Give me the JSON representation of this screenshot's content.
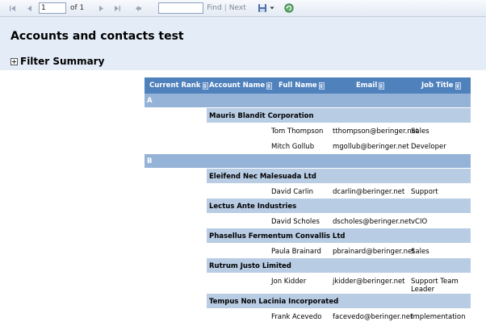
{
  "toolbar": {
    "page_value": "1",
    "of_label": "of 1",
    "find_label": "Find",
    "find_sep": "|",
    "next_label": "Next"
  },
  "report": {
    "title": "Accounts and contacts test",
    "filter_summary": "Filter Summary"
  },
  "table": {
    "columns": [
      "Current Rank",
      "Account Name",
      "Full Name",
      "Email",
      "Job Title"
    ],
    "groups": [
      {
        "label": "A",
        "accounts": [
          {
            "name": "Mauris Blandit Corporation",
            "contacts": [
              {
                "full_name": "Tom Thompson",
                "email": "tthompson@beringer.net",
                "job_title": "Sales"
              },
              {
                "full_name": "Mitch Gollub",
                "email": "mgollub@beringer.net",
                "job_title": "Developer"
              }
            ]
          }
        ]
      },
      {
        "label": "B",
        "accounts": [
          {
            "name": "Eleifend Nec Malesuada Ltd",
            "contacts": [
              {
                "full_name": "David Carlin",
                "email": "dcarlin@beringer.net",
                "job_title": "Support"
              }
            ]
          },
          {
            "name": "Lectus Ante Industries",
            "contacts": [
              {
                "full_name": "David Scholes",
                "email": "dscholes@beringer.net",
                "job_title": "vCIO"
              }
            ]
          },
          {
            "name": "Phasellus Fermentum Convallis Ltd",
            "contacts": [
              {
                "full_name": "Paula Brainard",
                "email": "pbrainard@beringer.net",
                "job_title": "Sales"
              }
            ]
          },
          {
            "name": "Rutrum Justo Limited",
            "contacts": [
              {
                "full_name": "Jon Kidder",
                "email": "jkidder@beringer.net",
                "job_title": "Support Team Leader"
              }
            ]
          },
          {
            "name": "Tempus Non Lacinia Incorporated",
            "contacts": [
              {
                "full_name": "Frank Acevedo",
                "email": "facevedo@beringer.net",
                "job_title": "Implementation"
              }
            ]
          }
        ]
      }
    ]
  }
}
